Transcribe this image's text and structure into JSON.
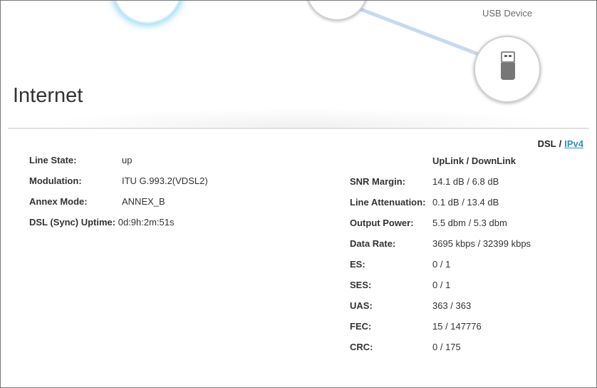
{
  "topology": {
    "usb_label": "USB Device"
  },
  "page_title": "Internet",
  "view_switch": {
    "dsl": "DSL",
    "separator": "/",
    "ipv4": "IPv4"
  },
  "left": [
    {
      "label": "Line State:",
      "value": "up"
    },
    {
      "label": "Modulation:",
      "value": "ITU G.993.2(VDSL2)"
    },
    {
      "label": "Annex Mode:",
      "value": "ANNEX_B"
    },
    {
      "label": "DSL (Sync) Uptime:",
      "value": "0d:9h:2m:51s"
    }
  ],
  "right_header": "UpLink / DownLink",
  "right": [
    {
      "label": "SNR Margin:",
      "value": "14.1 dB / 6.8 dB"
    },
    {
      "label": "Line Attenuation:",
      "value": "0.1 dB / 13.4 dB"
    },
    {
      "label": "Output Power:",
      "value": "5.5 dbm / 5.3 dbm"
    },
    {
      "label": "Data Rate:",
      "value": "3695 kbps / 32399 kbps"
    },
    {
      "label": "ES:",
      "value": "0 / 1"
    },
    {
      "label": "SES:",
      "value": "0 / 1"
    },
    {
      "label": "UAS:",
      "value": "363 / 363"
    },
    {
      "label": "FEC:",
      "value": "15 / 147776"
    },
    {
      "label": "CRC:",
      "value": "0 / 175"
    }
  ],
  "colors": {
    "accent": "#2e8fbd",
    "internet_glow": "#8fd7f5",
    "link_line": "#c8d9ee"
  }
}
